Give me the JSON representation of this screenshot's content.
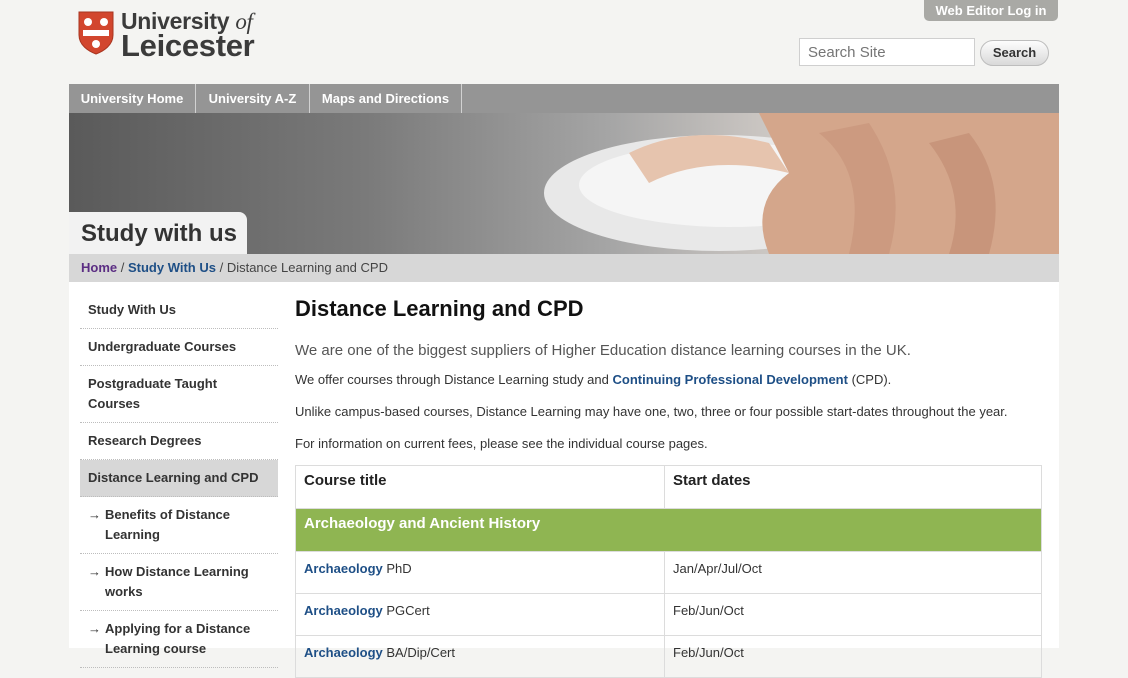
{
  "header": {
    "logo_line1": "University",
    "logo_of": "of",
    "logo_line2": "Leicester",
    "web_editor_login": "Web Editor Log in",
    "search_placeholder": "Search Site",
    "search_button": "Search"
  },
  "topnav": [
    "University Home",
    "University A-Z",
    "Maps and Directions"
  ],
  "banner": {
    "title": "Study with us"
  },
  "breadcrumb": {
    "home": "Home",
    "sep1": " / ",
    "study": "Study With Us",
    "sep2": " / ",
    "current": "Distance Learning and CPD"
  },
  "sidenav": {
    "items": [
      {
        "label": "Study With Us"
      },
      {
        "label": "Undergraduate Courses"
      },
      {
        "label": "Postgraduate Taught Courses"
      },
      {
        "label": "Research Degrees"
      },
      {
        "label": "Distance Learning and CPD",
        "active": true
      }
    ],
    "arrow": "→",
    "subitems": [
      {
        "label": "Benefits of Distance Learning"
      },
      {
        "label": "How Distance Learning works"
      },
      {
        "label": "Applying for a Distance Learning course"
      }
    ]
  },
  "main": {
    "title": "Distance Learning and CPD",
    "lead": "We are one of the biggest suppliers of Higher Education distance learning courses in the UK.",
    "offer_before": "We offer courses through Distance Learning study and ",
    "offer_link": "Continuing Professional Development",
    "offer_after": " (CPD).",
    "unlike": "Unlike campus-based courses, Distance Learning may have one, two, three or four possible start-dates throughout the year.",
    "fees": "For information on current fees, please see the individual course pages."
  },
  "table": {
    "headers": [
      "Course title",
      "Start dates"
    ],
    "group": "Archaeology and Ancient History",
    "rows": [
      {
        "link": "Archaeology",
        "suffix": " PhD",
        "dates": "Jan/Apr/Jul/Oct"
      },
      {
        "link": "Archaeology",
        "suffix": " PGCert",
        "dates": "Feb/Jun/Oct"
      },
      {
        "link": "Archaeology",
        "suffix": " BA/Dip/Cert",
        "dates": "Feb/Jun/Oct"
      }
    ]
  },
  "colors": {
    "accent_green": "#8fb552",
    "link_blue": "#1e4f86",
    "home_purple": "#5b2d83",
    "shield_red": "#d2462e"
  }
}
